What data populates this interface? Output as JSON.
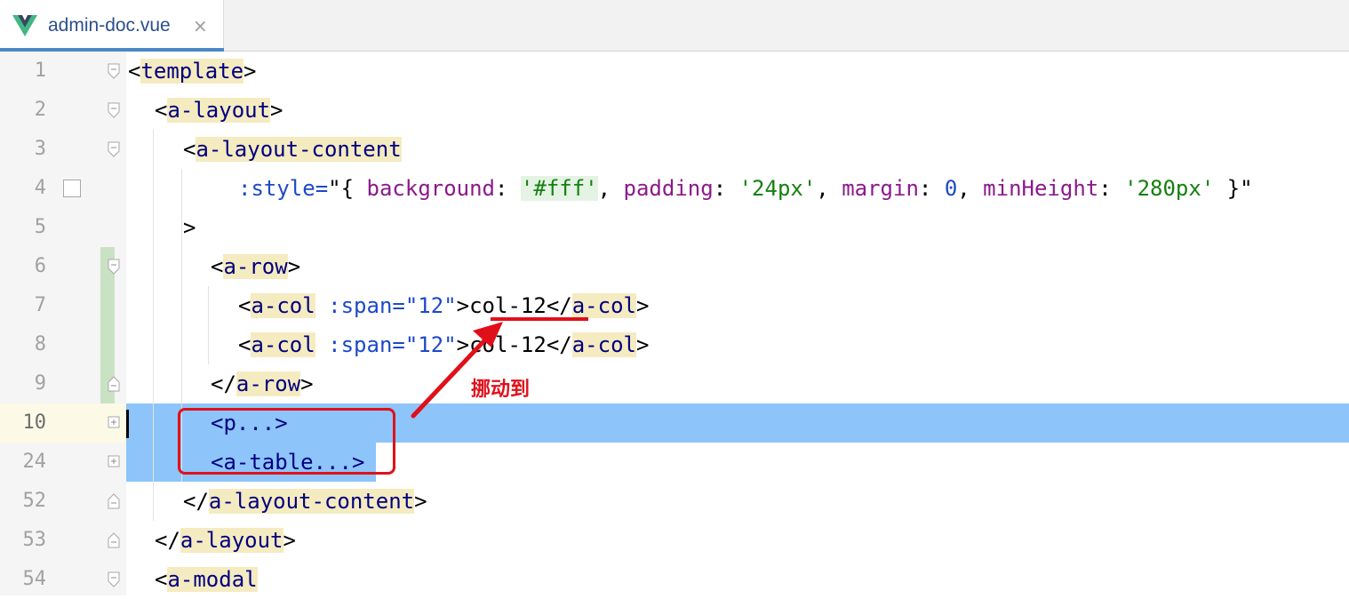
{
  "tab": {
    "filename": "admin-doc.vue",
    "close_glyph": "×",
    "icon": "vue-logo-icon"
  },
  "colors": {
    "tag_bg": "#f5ebc0",
    "selection": "#8dc4f9",
    "annotation_red": "#e0101a",
    "tab_underline": "#4a88c7"
  },
  "lines": [
    {
      "num": "1"
    },
    {
      "num": "2"
    },
    {
      "num": "3"
    },
    {
      "num": "4"
    },
    {
      "num": "5"
    },
    {
      "num": "6"
    },
    {
      "num": "7"
    },
    {
      "num": "8"
    },
    {
      "num": "9"
    },
    {
      "num": "10"
    },
    {
      "num": "24"
    },
    {
      "num": "52"
    },
    {
      "num": "53"
    },
    {
      "num": "54"
    }
  ],
  "code": {
    "l1": {
      "open": "<",
      "tag": "template",
      "close": ">"
    },
    "l2": {
      "open": "<",
      "tag": "a-layout",
      "close": ">"
    },
    "l3": {
      "open": "<",
      "tag": "a-layout-content"
    },
    "l4": {
      "attr": ":style=",
      "q1": "\"{ ",
      "k1": "background",
      "c1": ": ",
      "v1": "'#fff'",
      "s1": ", ",
      "k2": "padding",
      "c2": ": ",
      "v2": "'24px'",
      "s2": ", ",
      "k3": "margin",
      "c3": ": ",
      "v3": "0",
      "s3": ", ",
      "k4": "minHeight",
      "c4": ": ",
      "v4": "'280px'",
      "q2": " }\""
    },
    "l5": {
      "close": ">"
    },
    "l6": {
      "open": "<",
      "tag": "a-row",
      "close": ">"
    },
    "l7": {
      "open": "<",
      "tag": "a-col",
      "sp": " ",
      "attr": ":span=",
      "val": "\"12\"",
      "gt": ">",
      "text": "col-12",
      "lt": "</",
      "tag2": "a-col",
      "close": ">"
    },
    "l8": {
      "open": "<",
      "tag": "a-col",
      "sp": " ",
      "attr": ":span=",
      "val": "\"12\"",
      "gt": ">",
      "text": "col-12",
      "lt": "</",
      "tag2": "a-col",
      "close": ">"
    },
    "l9": {
      "open": "</",
      "tag": "a-row",
      "close": ">"
    },
    "l10": {
      "text": "<p...>"
    },
    "l24": {
      "text": "<a-table...>"
    },
    "l52": {
      "open": "</",
      "tag": "a-layout-content",
      "close": ">"
    },
    "l53": {
      "open": "</",
      "tag": "a-layout",
      "close": ">"
    },
    "l54": {
      "open": "<",
      "tag": "a-modal"
    }
  },
  "annotation": {
    "label": "挪动到"
  }
}
